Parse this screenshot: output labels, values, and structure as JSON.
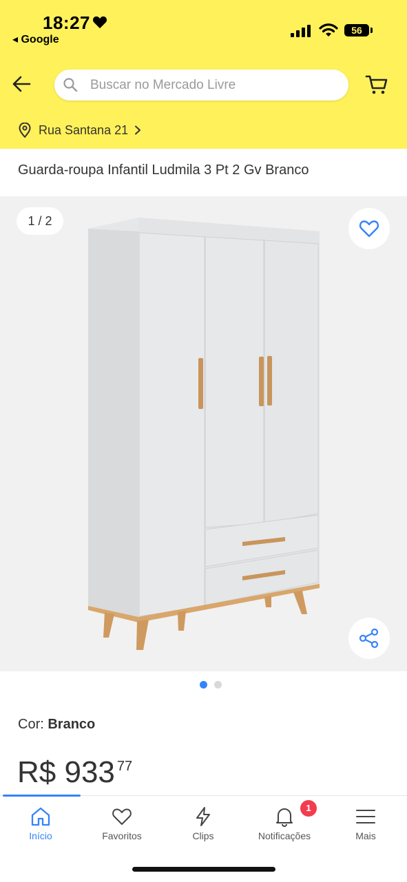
{
  "status_bar": {
    "time": "18:27",
    "back_app": "◂ Google",
    "battery": "56"
  },
  "header": {
    "search_placeholder": "Buscar no Mercado Livre",
    "location": "Rua Santana 21"
  },
  "product": {
    "title": "Guarda-roupa Infantil Ludmila 3 Pt 2 Gv Branco",
    "gallery_counter": "1 / 2",
    "gallery_index": 1,
    "gallery_total": 2,
    "color_label": "Cor:",
    "color_value": "Branco",
    "price_main": "R$ 933",
    "price_cents": "77"
  },
  "tabbar": {
    "items": [
      {
        "label": "Início",
        "icon": "home-icon",
        "active": true
      },
      {
        "label": "Favoritos",
        "icon": "heart-icon"
      },
      {
        "label": "Clips",
        "icon": "lightning-icon"
      },
      {
        "label": "Notificações",
        "icon": "bell-icon",
        "badge": "1"
      },
      {
        "label": "Mais",
        "icon": "menu-icon"
      }
    ]
  },
  "colors": {
    "brand_yellow": "#fff159",
    "accent_blue": "#3483fa",
    "badge_red": "#f23d4f"
  }
}
